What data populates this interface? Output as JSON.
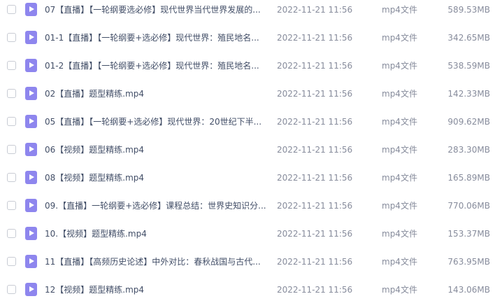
{
  "files": [
    {
      "name": "07【直播】【一轮纲要选必修】现代世界当代世界发展的...",
      "date": "2022-11-21 11:56",
      "type": "mp4文件",
      "size": "589.53MB"
    },
    {
      "name": "01-1【直播】【一轮纲要+选必修】现代世界：殖民地名...",
      "date": "2022-11-21 11:56",
      "type": "mp4文件",
      "size": "342.65MB"
    },
    {
      "name": "01-2【直播】【一轮纲要+选必修】现代世界：殖民地名...",
      "date": "2022-11-21 11:56",
      "type": "mp4文件",
      "size": "538.59MB"
    },
    {
      "name": "02【直播】题型精练.mp4",
      "date": "2022-11-21 11:56",
      "type": "mp4文件",
      "size": "142.33MB"
    },
    {
      "name": "05【直播】【一轮纲要+选必修】现代世界：20世纪下半...",
      "date": "2022-11-21 11:56",
      "type": "mp4文件",
      "size": "909.62MB"
    },
    {
      "name": "06【视频】题型精练.mp4",
      "date": "2022-11-21 11:56",
      "type": "mp4文件",
      "size": "283.30MB"
    },
    {
      "name": "08【视频】题型精练.mp4",
      "date": "2022-11-21 11:56",
      "type": "mp4文件",
      "size": "165.89MB"
    },
    {
      "name": "09.【直播】一轮纲要+选必修】课程总结：世界史知识分...",
      "date": "2022-11-21 11:56",
      "type": "mp4文件",
      "size": "770.06MB"
    },
    {
      "name": "10.【视频】题型精练.mp4",
      "date": "2022-11-21 11:56",
      "type": "mp4文件",
      "size": "153.37MB"
    },
    {
      "name": "11【直播】【高频历史论述】中外对比：春秋战国与古代...",
      "date": "2022-11-21 11:56",
      "type": "mp4文件",
      "size": "763.95MB"
    },
    {
      "name": "12【视频】题型精练.mp4",
      "date": "2022-11-21 11:56",
      "type": "mp4文件",
      "size": "143.06MB"
    }
  ],
  "icons": {
    "file": "video-file-icon"
  },
  "colors": {
    "icon": "#8e86ee",
    "text": "#424e67",
    "meta": "#878c9c"
  }
}
